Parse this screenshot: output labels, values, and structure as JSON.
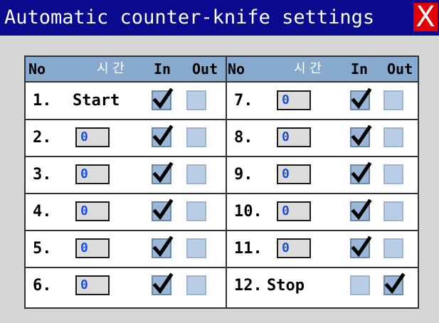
{
  "window": {
    "title": "Automatic counter-knife settings",
    "close_label": "X"
  },
  "table": {
    "headers": {
      "no": "No",
      "time": "시 간",
      "in": "In",
      "out": "Out"
    },
    "left": [
      {
        "no": "1.",
        "type": "text",
        "value": "Start",
        "in": true,
        "out": false
      },
      {
        "no": "2.",
        "type": "field",
        "value": "0",
        "in": true,
        "out": false
      },
      {
        "no": "3.",
        "type": "field",
        "value": "0",
        "in": true,
        "out": false
      },
      {
        "no": "4.",
        "type": "field",
        "value": "0",
        "in": true,
        "out": false
      },
      {
        "no": "5.",
        "type": "field",
        "value": "0",
        "in": true,
        "out": false
      },
      {
        "no": "6.",
        "type": "field",
        "value": "0",
        "in": true,
        "out": false
      }
    ],
    "right": [
      {
        "no": "7.",
        "type": "field",
        "value": "0",
        "in": true,
        "out": false
      },
      {
        "no": "8.",
        "type": "field",
        "value": "0",
        "in": true,
        "out": false
      },
      {
        "no": "9.",
        "type": "field",
        "value": "0",
        "in": true,
        "out": false
      },
      {
        "no": "10.",
        "type": "field",
        "value": "0",
        "in": true,
        "out": false
      },
      {
        "no": "11.",
        "type": "field",
        "value": "0",
        "in": true,
        "out": false
      },
      {
        "no": "12.",
        "type": "text",
        "value": "Stop",
        "in": false,
        "out": true
      }
    ]
  },
  "colors": {
    "titlebar": "#0a0a8e",
    "close": "#e40000",
    "header": "#88aace",
    "field_text": "#1d4fe0"
  }
}
